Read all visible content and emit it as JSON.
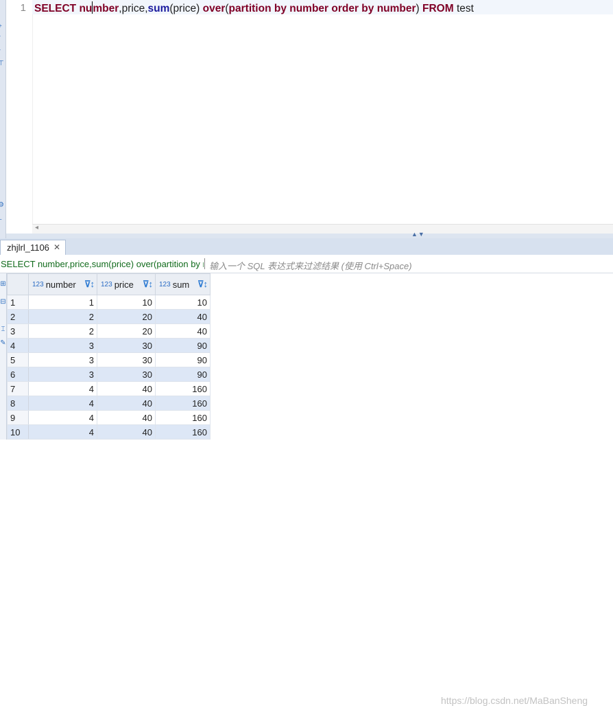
{
  "editor": {
    "line_number": "1",
    "sql_tokens": [
      {
        "text": "SELECT ",
        "kind": "keyword"
      },
      {
        "text": "nu",
        "kind": "keyword"
      },
      {
        "text": "caret",
        "kind": "caret"
      },
      {
        "text": "mber",
        "kind": "keyword"
      },
      {
        "text": ",price,",
        "kind": "plain"
      },
      {
        "text": "sum",
        "kind": "function"
      },
      {
        "text": "(price) ",
        "kind": "plain"
      },
      {
        "text": "over",
        "kind": "keyword"
      },
      {
        "text": "(",
        "kind": "plain"
      },
      {
        "text": "partition by number order by number",
        "kind": "keyword"
      },
      {
        "text": ") ",
        "kind": "plain"
      },
      {
        "text": "FROM",
        "kind": "keyword"
      },
      {
        "text": " test",
        "kind": "plain"
      }
    ]
  },
  "results": {
    "tab_label": "zhjlrl_1106",
    "tab_close_icon": "close-icon",
    "filter_sql": "SELECT number,price,sum(price) over(partition by number order by number) FROM test",
    "filter_placeholder": "输入一个 SQL 表达式来过滤结果 (使用 Ctrl+Space)",
    "columns": [
      {
        "type_label": "123",
        "name": "number"
      },
      {
        "type_label": "123",
        "name": "price"
      },
      {
        "type_label": "123",
        "name": "sum"
      }
    ],
    "rows": [
      {
        "row": "1",
        "number": "1",
        "price": "10",
        "sum": "10"
      },
      {
        "row": "2",
        "number": "2",
        "price": "20",
        "sum": "40"
      },
      {
        "row": "3",
        "number": "2",
        "price": "20",
        "sum": "40"
      },
      {
        "row": "4",
        "number": "3",
        "price": "30",
        "sum": "90"
      },
      {
        "row": "5",
        "number": "3",
        "price": "30",
        "sum": "90"
      },
      {
        "row": "6",
        "number": "3",
        "price": "30",
        "sum": "90"
      },
      {
        "row": "7",
        "number": "4",
        "price": "40",
        "sum": "160"
      },
      {
        "row": "8",
        "number": "4",
        "price": "40",
        "sum": "160"
      },
      {
        "row": "9",
        "number": "4",
        "price": "40",
        "sum": "160"
      },
      {
        "row": "10",
        "number": "4",
        "price": "40",
        "sum": "160"
      }
    ]
  },
  "watermark": "https://blog.csdn.net/MaBanSheng",
  "colors": {
    "keyword": "#7f0026",
    "function": "#1a1a9e",
    "filter_sql": "#116b1c",
    "alt_row": "#dde7f6"
  }
}
